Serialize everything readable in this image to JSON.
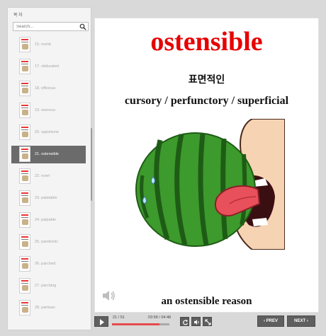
{
  "sidebar": {
    "title": "목 차",
    "search_placeholder": "Search...",
    "items": [
      {
        "label": "15. numb"
      },
      {
        "label": "17. obdurated"
      },
      {
        "label": "18. officious"
      },
      {
        "label": "19. onerous"
      },
      {
        "label": "20. opportune"
      },
      {
        "label": "21. ostensible",
        "active": true
      },
      {
        "label": "22. overt"
      },
      {
        "label": "23. palatable"
      },
      {
        "label": "24. palpable"
      },
      {
        "label": "25. pandemic"
      },
      {
        "label": "26. parched"
      },
      {
        "label": "27. parching"
      },
      {
        "label": "28. partisan"
      }
    ]
  },
  "card": {
    "word": "ostensible",
    "korean": "표면적인",
    "synonyms": "cursory / perfunctory / superficial",
    "example": "an ostensible reason"
  },
  "player": {
    "page": "21 / 51",
    "time": "03:58 / 04:48",
    "progress": 0.83,
    "prev_label": "PREV",
    "next_label": "NEXT"
  },
  "colors": {
    "word": "#e60000",
    "progress_fill": "#e64b4b",
    "active_item": "#6b6b6b"
  },
  "icons": {
    "search": "search-icon",
    "speaker": "speaker-icon",
    "play": "play-icon",
    "repeat": "repeat-icon",
    "volume": "volume-icon",
    "fullscreen": "fullscreen-icon"
  }
}
